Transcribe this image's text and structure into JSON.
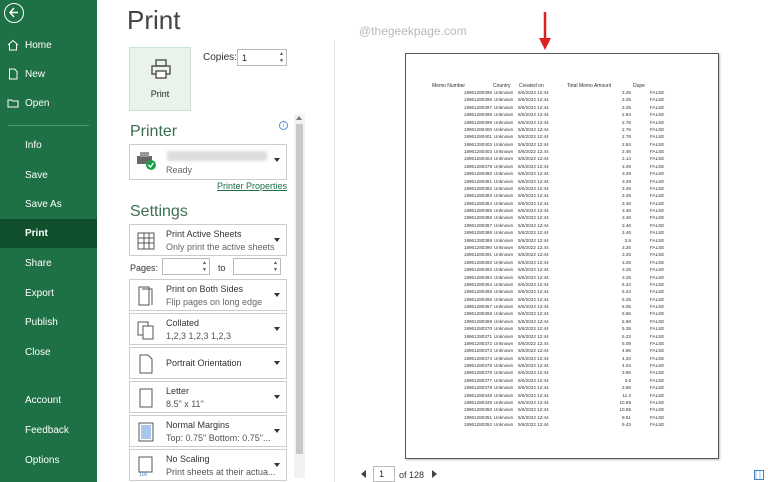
{
  "sidebar": {
    "items": [
      {
        "label": "Home",
        "icon": "home-icon"
      },
      {
        "label": "New",
        "icon": "new-file-icon"
      },
      {
        "label": "Open",
        "icon": "open-folder-icon"
      },
      {
        "label": "Info"
      },
      {
        "label": "Save"
      },
      {
        "label": "Save As"
      },
      {
        "label": "Print",
        "active": true
      },
      {
        "label": "Share"
      },
      {
        "label": "Export"
      },
      {
        "label": "Publish"
      },
      {
        "label": "Close"
      },
      {
        "label": "Account"
      },
      {
        "label": "Feedback"
      },
      {
        "label": "Options"
      }
    ],
    "bg_color": "#1e7145"
  },
  "print": {
    "title": "Print",
    "button_label": "Print",
    "copies_label": "Copies:",
    "copies_value": "1"
  },
  "printer": {
    "heading": "Printer",
    "status": "Ready",
    "properties_link": "Printer Properties"
  },
  "settings": {
    "heading": "Settings",
    "pages_label": "Pages:",
    "to_label": "to",
    "dropdowns": [
      {
        "line1": "Print Active Sheets",
        "line2": "Only print the active sheets",
        "icon": "sheets-grid-icon"
      },
      {
        "line1": "Print on Both Sides",
        "line2": "Flip pages on long edge",
        "icon": "duplex-icon"
      },
      {
        "line1": "Collated",
        "line2": "1,2,3    1,2,3    1,2,3",
        "icon": "collate-icon"
      },
      {
        "line1": "Portrait Orientation",
        "line2": "",
        "icon": "portrait-icon"
      },
      {
        "line1": "Letter",
        "line2": "8.5\" x 11\"",
        "icon": "paper-icon"
      },
      {
        "line1": "Normal Margins",
        "line2": "Top: 0.75\" Bottom: 0.75\"...",
        "icon": "margins-icon"
      },
      {
        "line1": "No Scaling",
        "line2": "Print sheets at their actua...",
        "icon": "scaling-icon"
      }
    ]
  },
  "preview": {
    "watermark": "@thegeekpage.com",
    "headers": [
      "Memo Number",
      "Country",
      "Created on",
      "Total Memo Amount",
      "Dupe"
    ],
    "rows": [
      [
        "18961280395",
        "Unknown",
        "5/6/2022 12:44",
        "3.25",
        "FALSE"
      ],
      [
        "18961280396",
        "Unknown",
        "5/6/2022 12:44",
        "3.25",
        "FALSE"
      ],
      [
        "18961280397",
        "Unknown",
        "5/6/2022 12:44",
        "3.25",
        "FALSE"
      ],
      [
        "18961280398",
        "Unknown",
        "5/6/2022 12:44",
        "2.84",
        "FALSE"
      ],
      [
        "18961280399",
        "Unknown",
        "5/6/2022 12:44",
        "2.76",
        "FALSE"
      ],
      [
        "18961280400",
        "Unknown",
        "5/6/2022 12:44",
        "2.76",
        "FALSE"
      ],
      [
        "18961280401",
        "Unknown",
        "5/6/2022 12:44",
        "2.76",
        "FALSE"
      ],
      [
        "18961280402",
        "Unknown",
        "5/6/2022 12:44",
        "2.84",
        "FALSE"
      ],
      [
        "18961280403",
        "Unknown",
        "5/6/2022 12:44",
        "2.46",
        "FALSE"
      ],
      [
        "18961280404",
        "Unknown",
        "5/6/2022 12:44",
        "2.14",
        "FALSE"
      ],
      [
        "18961280379",
        "Unknown",
        "5/6/2022 12:44",
        "3.49",
        "FALSE"
      ],
      [
        "18961280380",
        "Unknown",
        "5/6/2022 12:44",
        "3.49",
        "FALSE"
      ],
      [
        "18961280381",
        "Unknown",
        "5/6/2022 12:44",
        "3.49",
        "FALSE"
      ],
      [
        "18961280382",
        "Unknown",
        "5/6/2022 12:44",
        "3.49",
        "FALSE"
      ],
      [
        "18961280383",
        "Unknown",
        "5/6/2022 12:44",
        "3.49",
        "FALSE"
      ],
      [
        "18961280384",
        "Unknown",
        "5/6/2022 12:44",
        "3.48",
        "FALSE"
      ],
      [
        "18961280385",
        "Unknown",
        "5/6/2022 12:44",
        "3.48",
        "FALSE"
      ],
      [
        "18961280386",
        "Unknown",
        "5/6/2022 12:44",
        "3.48",
        "FALSE"
      ],
      [
        "18961280387",
        "Unknown",
        "5/6/2022 12:44",
        "3.46",
        "FALSE"
      ],
      [
        "18961280388",
        "Unknown",
        "5/6/2022 12:44",
        "3.46",
        "FALSE"
      ],
      [
        "18961280389",
        "Unknown",
        "5/6/2022 12:44",
        "3.5",
        "FALSE"
      ],
      [
        "18961280390",
        "Unknown",
        "5/6/2022 12:44",
        "3.25",
        "FALSE"
      ],
      [
        "18961280391",
        "Unknown",
        "5/6/2022 12:44",
        "3.25",
        "FALSE"
      ],
      [
        "18961280392",
        "Unknown",
        "5/6/2022 12:44",
        "3.25",
        "FALSE"
      ],
      [
        "18961280393",
        "Unknown",
        "5/6/2022 12:44",
        "3.25",
        "FALSE"
      ],
      [
        "18961280394",
        "Unknown",
        "5/6/2022 12:44",
        "3.25",
        "FALSE"
      ],
      [
        "18961280364",
        "Unknown",
        "5/6/2022 12:44",
        "6.43",
        "FALSE"
      ],
      [
        "18961280365",
        "Unknown",
        "5/6/2022 12:44",
        "6.43",
        "FALSE"
      ],
      [
        "18961280366",
        "Unknown",
        "5/6/2022 12:44",
        "6.25",
        "FALSE"
      ],
      [
        "18961280367",
        "Unknown",
        "5/6/2022 12:44",
        "6.05",
        "FALSE"
      ],
      [
        "18961280368",
        "Unknown",
        "5/6/2022 12:44",
        "5.66",
        "FALSE"
      ],
      [
        "18961280369",
        "Unknown",
        "5/6/2022 12:44",
        "5.58",
        "FALSE"
      ],
      [
        "18961280370",
        "Unknown",
        "5/6/2022 12:44",
        "5.39",
        "FALSE"
      ],
      [
        "18961280371",
        "Unknown",
        "5/6/2022 12:44",
        "5.23",
        "FALSE"
      ],
      [
        "18961280372",
        "Unknown",
        "5/6/2022 12:44",
        "5.08",
        "FALSE"
      ],
      [
        "18961280373",
        "Unknown",
        "5/6/2022 12:44",
        "4.86",
        "FALSE"
      ],
      [
        "18961280374",
        "Unknown",
        "5/6/2022 12:44",
        "4.34",
        "FALSE"
      ],
      [
        "18961280375",
        "Unknown",
        "5/6/2022 12:44",
        "4.04",
        "FALSE"
      ],
      [
        "18961280376",
        "Unknown",
        "5/6/2022 12:44",
        "3.86",
        "FALSE"
      ],
      [
        "18961280377",
        "Unknown",
        "5/6/2022 12:44",
        "3.6",
        "FALSE"
      ],
      [
        "18961280378",
        "Unknown",
        "5/6/2022 12:44",
        "3.59",
        "FALSE"
      ],
      [
        "18961280348",
        "Unknown",
        "5/6/2022 12:44",
        "11.3",
        "FALSE"
      ],
      [
        "18961280349",
        "Unknown",
        "5/6/2022 12:44",
        "10.85",
        "FALSE"
      ],
      [
        "18961280350",
        "Unknown",
        "5/6/2022 12:44",
        "10.85",
        "FALSE"
      ],
      [
        "18961280351",
        "Unknown",
        "5/6/2022 12:44",
        "9.51",
        "FALSE"
      ],
      [
        "18961280352",
        "Unknown",
        "5/6/2022 12:44",
        "9.43",
        "FALSE"
      ]
    ]
  },
  "pager": {
    "current": "1",
    "of_label": "of 128"
  },
  "colors": {
    "accent": "#1e7145",
    "arrow": "#e02020"
  }
}
